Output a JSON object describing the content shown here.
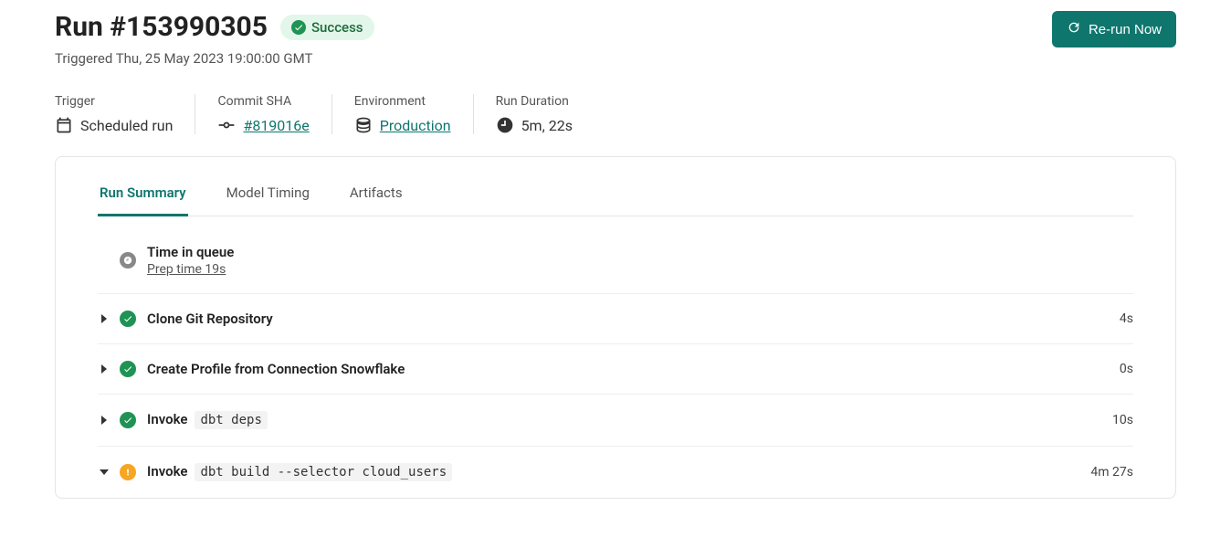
{
  "header": {
    "title": "Run #153990305",
    "status_label": "Success",
    "triggered": "Triggered Thu, 25 May 2023 19:00:00 GMT",
    "rerun_label": "Re-run Now"
  },
  "meta": {
    "trigger_label": "Trigger",
    "trigger_value": "Scheduled run",
    "commit_label": "Commit SHA",
    "commit_value": "#819016e",
    "environment_label": "Environment",
    "environment_value": "Production",
    "duration_label": "Run Duration",
    "duration_value": "5m, 22s"
  },
  "tabs": [
    {
      "label": "Run Summary",
      "active": true
    },
    {
      "label": "Model Timing",
      "active": false
    },
    {
      "label": "Artifacts",
      "active": false
    }
  ],
  "queue": {
    "title": "Time in queue",
    "sub": "Prep time 19s"
  },
  "steps": [
    {
      "status": "success",
      "title": "Clone Git Repository",
      "code": "",
      "duration": "4s",
      "expanded": false
    },
    {
      "status": "success",
      "title": "Create Profile from Connection Snowflake",
      "code": "",
      "duration": "0s",
      "expanded": false
    },
    {
      "status": "success",
      "title": "Invoke",
      "code": "dbt deps",
      "duration": "10s",
      "expanded": false
    },
    {
      "status": "warn",
      "title": "Invoke",
      "code": "dbt build --selector cloud_users",
      "duration": "4m 27s",
      "expanded": true
    }
  ]
}
